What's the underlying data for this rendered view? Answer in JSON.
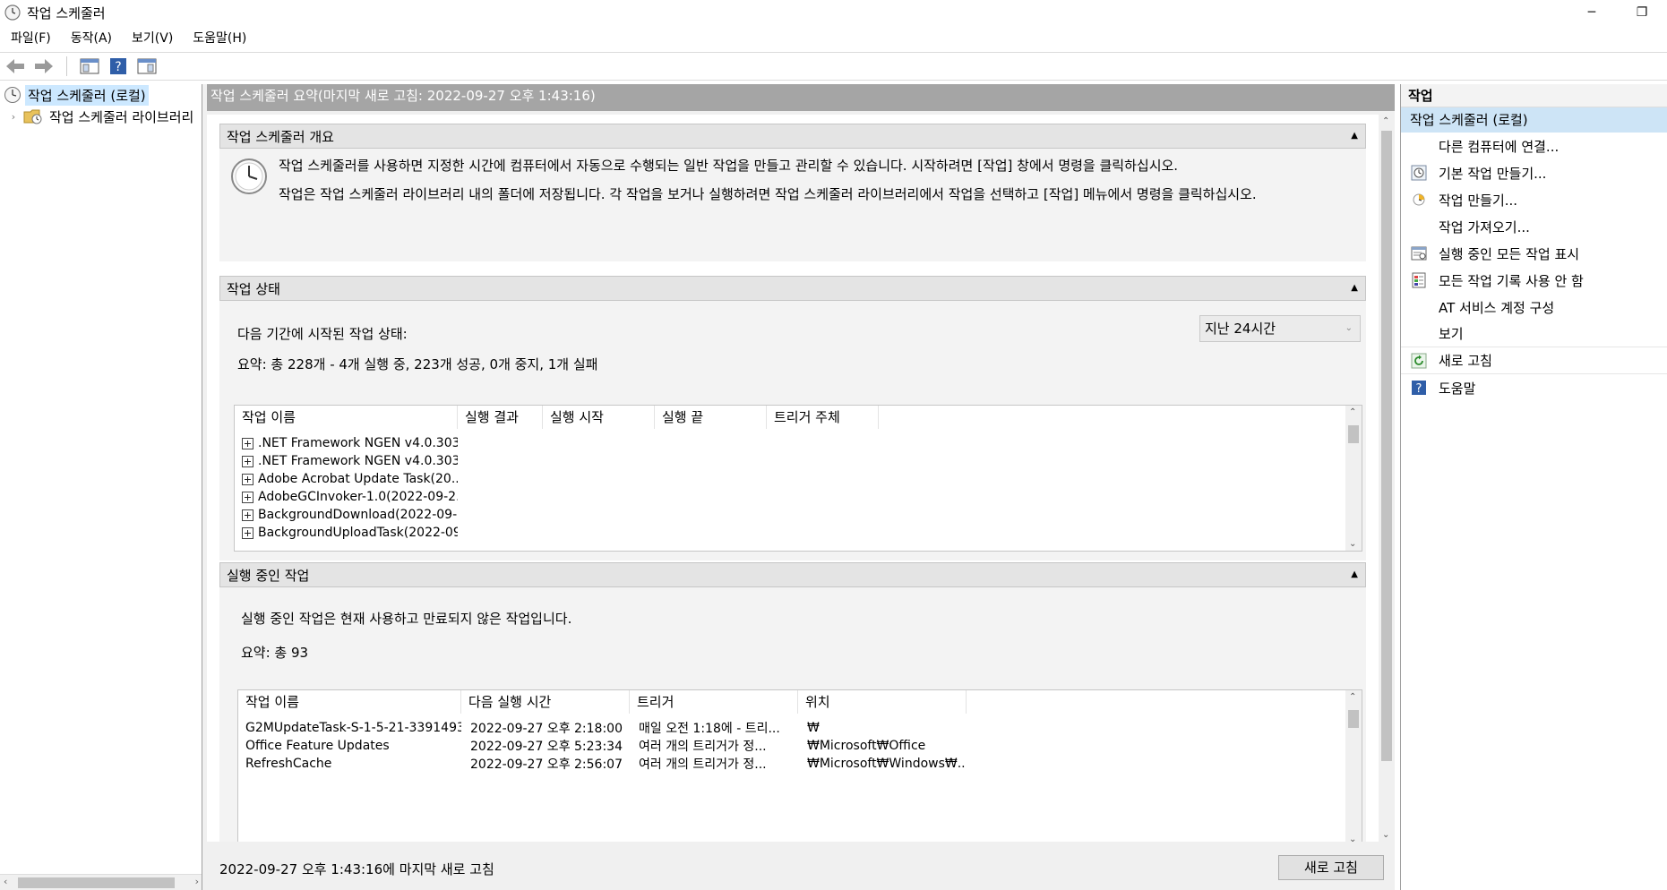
{
  "window": {
    "title": "작업 스케줄러",
    "minimize_glyph": "─",
    "restore_glyph": "❐"
  },
  "menu": [
    "파일(F)",
    "동작(A)",
    "보기(V)",
    "도움말(H)"
  ],
  "tree": {
    "root_label": "작업 스케줄러 (로컬)",
    "child_label": "작업 스케줄러 라이브러리"
  },
  "center": {
    "header": "작업 스케줄러 요약(마지막 새로 고침: 2022-09-27 오후 1:43:16)",
    "overview": {
      "title": "작업 스케줄러 개요",
      "line1": "작업 스케줄러를 사용하면 지정한 시간에 컴퓨터에서 자동으로 수행되는 일반 작업을 만들고 관리할 수 있습니다. 시작하려면 [작업] 창에서 명령을 클릭하십시오.",
      "line2": "작업은 작업 스케줄러 라이브러리 내의 폴더에 저장됩니다. 각 작업을 보거나 실행하려면 작업 스케줄러 라이브러리에서 작업을 선택하고 [작업] 메뉴에서 명령을 클릭하십시오."
    },
    "status": {
      "title": "작업 상태",
      "period_label": "다음 기간에 시작된 작업 상태:",
      "period_value": "지난 24시간",
      "summary": "요약: 총 228개 - 4개 실행 중, 223개 성공, 0개 중지, 1개 실패",
      "columns": [
        "작업 이름",
        "실행 결과",
        "실행 시작",
        "실행 끝",
        "트리거 주체"
      ],
      "rows": [
        ".NET Framework NGEN v4.0.303...",
        ".NET Framework NGEN v4.0.303...",
        "Adobe Acrobat Update Task(20...",
        "AdobeGCInvoker-1.0(2022-09-2...",
        "BackgroundDownload(2022-09-...",
        "BackgroundUploadTask(2022-09-..."
      ]
    },
    "running": {
      "title": "실행 중인 작업",
      "description": "실행 중인 작업은 현재 사용하고 만료되지 않은 작업입니다.",
      "summary": "요약: 총 93",
      "columns": [
        "작업 이름",
        "다음 실행 시간",
        "트리거",
        "위치"
      ],
      "rows": [
        {
          "name": "G2MUpdateTask-S-1-5-21-3391493...",
          "next": "2022-09-27 오후 2:18:00",
          "trigger": "매일 오전 1:18에 - 트리...",
          "location": "₩"
        },
        {
          "name": "Office Feature Updates",
          "next": "2022-09-27 오후 5:23:34",
          "trigger": "여러 개의 트리거가 정...",
          "location": "₩Microsoft₩Office"
        },
        {
          "name": "RefreshCache",
          "next": "2022-09-27 오후 2:56:07",
          "trigger": "여러 개의 트리거가 정...",
          "location": "₩Microsoft₩Windows₩..."
        }
      ]
    },
    "footer_text": "2022-09-27 오후 1:43:16에 마지막 새로 고침",
    "refresh_button": "새로 고침"
  },
  "actions": {
    "title": "작업",
    "group": "작업 스케줄러 (로컬)",
    "items": [
      {
        "label": "다른 컴퓨터에 연결...",
        "icon": ""
      },
      {
        "label": "기본 작업 만들기...",
        "icon": "basic-task-icon"
      },
      {
        "label": "작업 만들기...",
        "icon": "create-task-icon"
      },
      {
        "label": "작업 가져오기...",
        "icon": ""
      },
      {
        "label": "실행 중인 모든 작업 표시",
        "icon": "running-tasks-icon"
      },
      {
        "label": "모든 작업 기록 사용 안 함",
        "icon": "history-icon"
      },
      {
        "label": "AT 서비스 계정 구성",
        "icon": ""
      },
      {
        "label": "보기",
        "icon": ""
      },
      {
        "label": "새로 고침",
        "icon": "refresh-icon"
      },
      {
        "label": "도움말",
        "icon": "help-icon"
      }
    ]
  },
  "colors": {
    "header_gray": "#a5a5a5",
    "selection": "#cce8ff",
    "group_highlight": "#cde4f6"
  }
}
